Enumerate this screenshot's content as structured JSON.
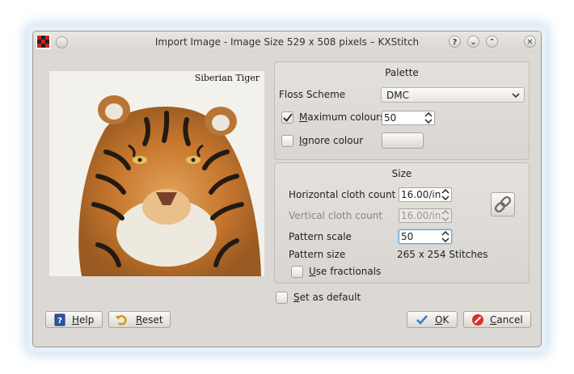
{
  "window": {
    "title": "Import Image - Image Size 529 x 508 pixels – KXStitch",
    "help_glyph": "?",
    "minimize_glyph": "⌄",
    "maximize_glyph": "⌃",
    "close_glyph": "✕"
  },
  "preview": {
    "label": "Siberian Tiger"
  },
  "palette": {
    "title": "Palette",
    "floss_scheme_label": "Floss Scheme",
    "floss_scheme_value": "DMC",
    "max_colours_label_first": "M",
    "max_colours_label_rest": "aximum colours",
    "max_colours_checked": true,
    "max_colours_value": "50",
    "ignore_colour_label_first": "I",
    "ignore_colour_label_rest": "gnore colour",
    "ignore_colour_checked": false
  },
  "size": {
    "title": "Size",
    "horizontal_label": "Horizontal cloth count",
    "horizontal_value": "16.00/in",
    "vertical_label": "Vertical cloth count",
    "vertical_value": "16.00/in",
    "pattern_scale_label": "Pattern scale",
    "pattern_scale_value": "50",
    "pattern_size_label": "Pattern size",
    "pattern_size_value": "265 x 254 Stitches",
    "fractionals_label_first": "U",
    "fractionals_label_rest": "se fractionals",
    "fractionals_checked": false
  },
  "set_default": {
    "label_first": "S",
    "label_rest": "et as default",
    "checked": false
  },
  "buttons": {
    "help_first": "H",
    "help_rest": "elp",
    "reset_first": "R",
    "reset_rest": "eset",
    "ok_first": "O",
    "ok_rest": "K",
    "cancel_first": "C",
    "cancel_rest": "ancel"
  },
  "colors": {
    "accent": "#5a9fe0",
    "cancel_icon": "#d8312a",
    "ok_icon": "#3a7cc9"
  }
}
